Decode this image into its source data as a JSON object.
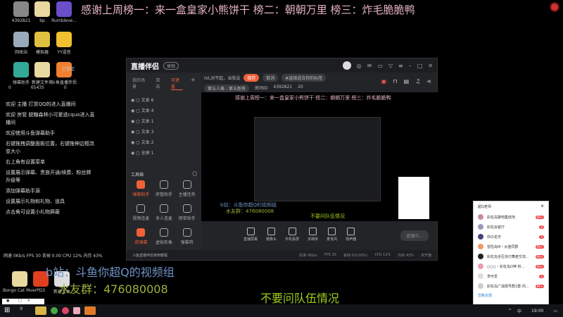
{
  "banner": "感谢上周榜一：来一盒皇家小熊饼干 榜二：朝朝万里 榜三：炸毛脆脆鸭",
  "desktop_icons": [
    {
      "label": "4392821",
      "color": "#888"
    },
    {
      "label": "bp",
      "color": "#e8d9a0"
    },
    {
      "label": "Rumbleve...",
      "color": "#6a4fc8"
    },
    {
      "label": "回收站",
      "color": "#9ab"
    },
    {
      "label": "模拟器",
      "color": "#e0c040"
    },
    {
      "label": "YY语音",
      "color": "#f0c030"
    },
    {
      "label": "弹幕助手",
      "color": "#3a9"
    },
    {
      "label": "新建文件夹",
      "color": "#e8d9a0"
    },
    {
      "label": "斗鱼直播伴侣",
      "color": "#f08030"
    },
    {
      "label": "Bongo Cat Mver",
      "color": "#e8d9a0"
    },
    {
      "label": "PD3",
      "color": "#e04020"
    },
    {
      "label": "新建文本",
      "color": "#ddd"
    }
  ],
  "top_stats": {
    "lock": "已锁定",
    "likes": "0",
    "fans": "65435",
    "crown": "0"
  },
  "chat": [
    "欢迎 主播 打赏QQ的进入直播间",
    "欢迎 房管 脱糖森林小可爱逃cquo进入直播间",
    "欢迎使用斗鱼弹幕助手",
    "右键拖拽调整面板位置，右键拖伸边框改变大小",
    "右上角有设置菜单",
    "设置展示弹幕、贵族开通/续费、粉丝牌升级等",
    "添加弹幕助手源",
    "设置展示礼物和礼物、道具",
    "点击角可设置小礼物屏蔽"
  ],
  "stats_line": "网速 0Kb/s  FPS 30  丢帧 0.00  CPU 12%  内存 43%",
  "overlays": {
    "bili": "b站：斗鱼你超Q的视频组",
    "qq": "水友群：476080008",
    "noask": "不要问队伍情况"
  },
  "app": {
    "title": "直播伴侣",
    "version": "体验",
    "tabs": [
      "我的场景",
      "双击",
      "可遮盖"
    ],
    "layers": [
      "文本 6",
      "文本 4",
      "文本 1",
      "文本 3",
      "文本 2",
      "全屏 1"
    ],
    "tools_title": "工具箱",
    "tools": [
      "弹幕助手",
      "房管助手",
      "主播任务",
      "视频连麦",
      "多人连麦",
      "榜单助手",
      "皮弹幕",
      "虚拟形象",
      "弹幕鸡"
    ],
    "stream_title": "IVL对不起，当我没",
    "save": "保存",
    "cancel": "取消",
    "tag": "#选择适合你的标签",
    "category": "第五人格 - 第五新秀",
    "room_label": "房间ID",
    "room_id": "4392821",
    "heat": "20",
    "preview_banner": "感谢上周榜一：来一盒皇家小熊饼干 榜二：朝朝万里 榜三：炸毛脆脆鸭",
    "preview_bili": "b站：斗鱼你超Q的视频组",
    "preview_qq": "水友群：476080008",
    "preview_noask": "不要问队伍情况",
    "controls": [
      "直播屏幕",
      "摄像头",
      "手机投屏",
      "多媒体",
      "麦克风",
      "扬声器"
    ],
    "live_btn": "直播中...",
    "footer_tip": "斗鱼直播伴侣使用教程",
    "status": [
      "码率 0Kb/s",
      "FPS 30",
      "丢帧 0(0.00%)",
      "CPU 12%",
      "内存 43%",
      "未开播"
    ]
  },
  "notif": {
    "title": "超Q老师",
    "items": [
      {
        "name": "彩虹岛聊吧集结地",
        "badge": "99+"
      },
      {
        "name": "彩虹会客厅",
        "badge": "8"
      },
      {
        "name": "你の名字",
        "badge": "5"
      },
      {
        "name": "冒险岛M丶水盘同群",
        "badge": "99+"
      },
      {
        "name": "彩虹岛全区剑刃舞者交流...",
        "badge": "99+"
      },
      {
        "name": "○○○・彩虹岛O神 粉...",
        "badge": "99+"
      },
      {
        "name": "李可爱",
        "badge": "1"
      },
      {
        "name": "彩虹岛广成朋号群1群-风...",
        "badge": "99+"
      }
    ],
    "ignore_all": "忽略全部"
  },
  "taskbar": {
    "time": "19:00",
    "ime": "中"
  }
}
